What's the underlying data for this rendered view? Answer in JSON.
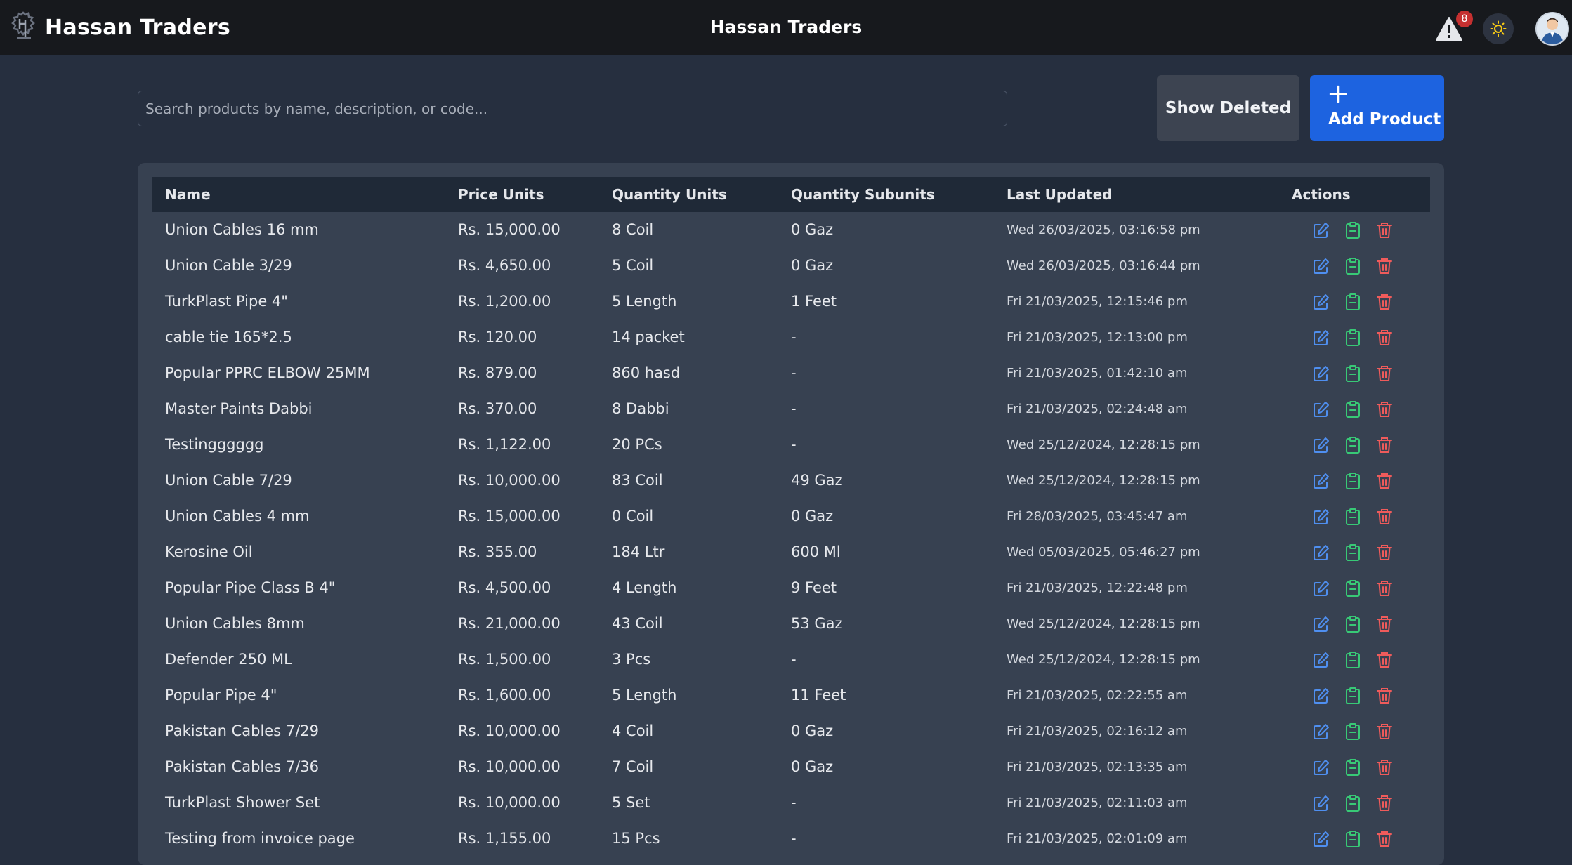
{
  "app": {
    "brand_name": "Hassan Traders",
    "center_title": "Hassan Traders",
    "notification_count": "8"
  },
  "toolbar": {
    "search_placeholder": "Search products by name, description, or code...",
    "show_deleted_label": "Show Deleted",
    "add_product_label": "Add Product"
  },
  "table": {
    "headers": {
      "name": "Name",
      "price": "Price Units",
      "qty": "Quantity Units",
      "subunits": "Quantity Subunits",
      "updated": "Last Updated",
      "actions": "Actions"
    },
    "rows": [
      {
        "name": "Union Cables 16 mm",
        "price": "Rs. 15,000.00",
        "qty": "8 Coil",
        "subunits": "0 Gaz",
        "updated": "Wed 26/03/2025, 03:16:58 pm"
      },
      {
        "name": "Union Cable 3/29",
        "price": "Rs. 4,650.00",
        "qty": "5 Coil",
        "subunits": "0 Gaz",
        "updated": "Wed 26/03/2025, 03:16:44 pm"
      },
      {
        "name": "TurkPlast Pipe 4\"",
        "price": "Rs. 1,200.00",
        "qty": "5 Length",
        "subunits": "1 Feet",
        "updated": "Fri 21/03/2025, 12:15:46 pm"
      },
      {
        "name": "cable tie 165*2.5",
        "price": "Rs. 120.00",
        "qty": "14 packet",
        "subunits": "-",
        "updated": "Fri 21/03/2025, 12:13:00 pm"
      },
      {
        "name": "Popular PPRC ELBOW 25MM",
        "price": "Rs. 879.00",
        "qty": "860 hasd",
        "subunits": "-",
        "updated": "Fri 21/03/2025, 01:42:10 am"
      },
      {
        "name": "Master Paints Dabbi",
        "price": "Rs. 370.00",
        "qty": "8 Dabbi",
        "subunits": "-",
        "updated": "Fri 21/03/2025, 02:24:48 am"
      },
      {
        "name": "Testingggggg",
        "price": "Rs. 1,122.00",
        "qty": "20 PCs",
        "subunits": "-",
        "updated": "Wed 25/12/2024, 12:28:15 pm"
      },
      {
        "name": "Union Cable 7/29",
        "price": "Rs. 10,000.00",
        "qty": "83 Coil",
        "subunits": "49 Gaz",
        "updated": "Wed 25/12/2024, 12:28:15 pm"
      },
      {
        "name": "Union Cables 4 mm",
        "price": "Rs. 15,000.00",
        "qty": "0 Coil",
        "subunits": "0 Gaz",
        "updated": "Fri 28/03/2025, 03:45:47 am"
      },
      {
        "name": "Kerosine Oil",
        "price": "Rs. 355.00",
        "qty": "184 Ltr",
        "subunits": "600 Ml",
        "updated": "Wed 05/03/2025, 05:46:27 pm"
      },
      {
        "name": "Popular Pipe Class B 4\"",
        "price": "Rs. 4,500.00",
        "qty": "4 Length",
        "subunits": "9 Feet",
        "updated": "Fri 21/03/2025, 12:22:48 pm"
      },
      {
        "name": "Union Cables 8mm",
        "price": "Rs. 21,000.00",
        "qty": "43 Coil",
        "subunits": "53 Gaz",
        "updated": "Wed 25/12/2024, 12:28:15 pm"
      },
      {
        "name": "Defender 250 ML",
        "price": "Rs. 1,500.00",
        "qty": "3 Pcs",
        "subunits": "-",
        "updated": "Wed 25/12/2024, 12:28:15 pm"
      },
      {
        "name": "Popular Pipe 4\"",
        "price": "Rs. 1,600.00",
        "qty": "5 Length",
        "subunits": "11 Feet",
        "updated": "Fri 21/03/2025, 02:22:55 am"
      },
      {
        "name": "Pakistan Cables 7/29",
        "price": "Rs. 10,000.00",
        "qty": "4 Coil",
        "subunits": "0 Gaz",
        "updated": "Fri 21/03/2025, 02:16:12 am"
      },
      {
        "name": "Pakistan Cables 7/36",
        "price": "Rs. 10,000.00",
        "qty": "7 Coil",
        "subunits": "0 Gaz",
        "updated": "Fri 21/03/2025, 02:13:35 am"
      },
      {
        "name": "TurkPlast Shower Set",
        "price": "Rs. 10,000.00",
        "qty": "5 Set",
        "subunits": "-",
        "updated": "Fri 21/03/2025, 02:11:03 am"
      },
      {
        "name": "Testing from invoice page",
        "price": "Rs. 1,155.00",
        "qty": "15 Pcs",
        "subunits": "-",
        "updated": "Fri 21/03/2025, 02:01:09 am"
      }
    ]
  },
  "icons": {
    "edit": "edit-icon",
    "stock": "clipboard-icon",
    "delete": "trash-icon",
    "alert": "warning-icon",
    "theme": "sun-icon",
    "add": "plus-icon"
  },
  "colors": {
    "edit": "#4f8ff0",
    "stock": "#38c976",
    "delete": "#ef5b5b",
    "primary": "#1d63e0"
  }
}
